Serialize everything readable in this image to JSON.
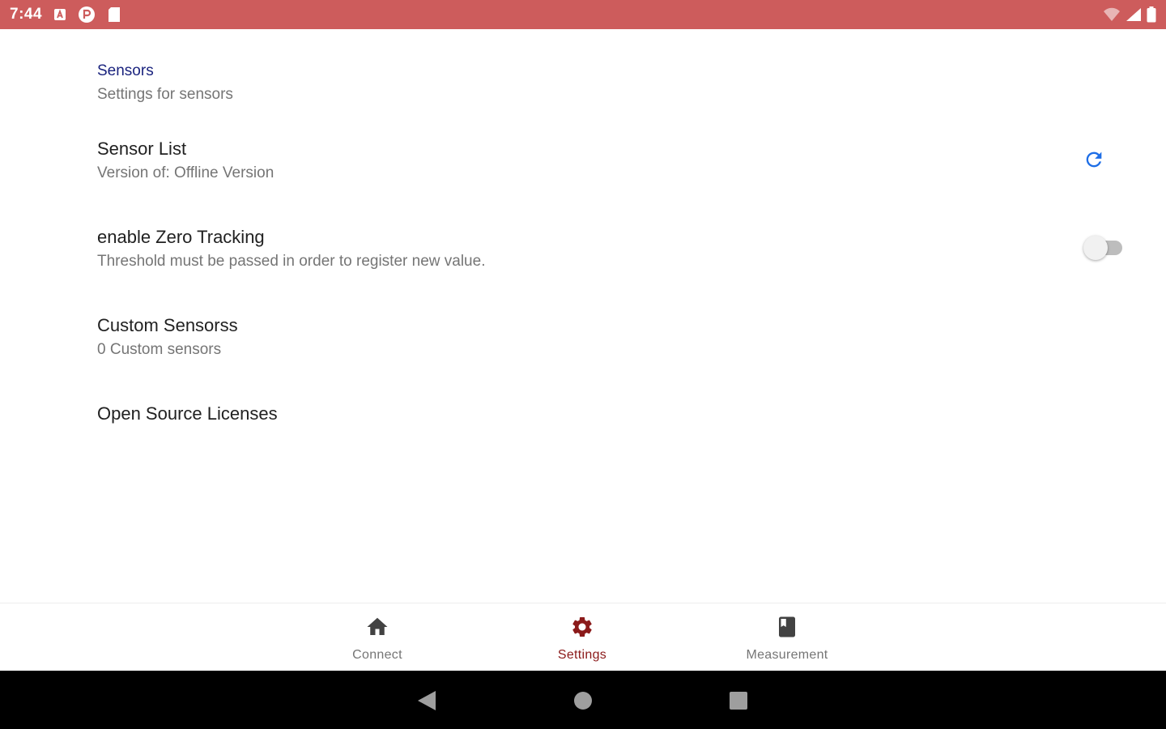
{
  "status_bar": {
    "time": "7:44",
    "color": "#cd5c5c",
    "left_icons": [
      "a-notification-icon",
      "p-notification-icon",
      "sd-card-icon"
    ],
    "right_icons": [
      "wifi-icon",
      "signal-icon",
      "battery-icon"
    ]
  },
  "category": {
    "title": "Sensors",
    "summary": "Settings for sensors"
  },
  "preferences": [
    {
      "title": "Sensor List",
      "summary": "Version of: Offline Version",
      "widget": "refresh-icon"
    },
    {
      "title": "enable Zero Tracking",
      "summary": "Threshold must be passed in order to register new value.",
      "widget": "switch",
      "checked": false
    },
    {
      "title": "Custom Sensorss",
      "summary": "0 Custom sensors"
    },
    {
      "title": "Open Source Licenses",
      "summary": ""
    }
  ],
  "bottom_nav": {
    "items": [
      {
        "label": "Connect",
        "icon": "home-icon",
        "selected": false
      },
      {
        "label": "Settings",
        "icon": "gear-icon",
        "selected": true
      },
      {
        "label": "Measurement",
        "icon": "notebook-icon",
        "selected": false
      }
    ],
    "selected_color": "#8b1a1a",
    "inactive_color": "#757575"
  },
  "system_nav": {
    "buttons": [
      "back-icon",
      "home-circle-icon",
      "recents-icon"
    ]
  },
  "accent_color": "#1e6ee6"
}
